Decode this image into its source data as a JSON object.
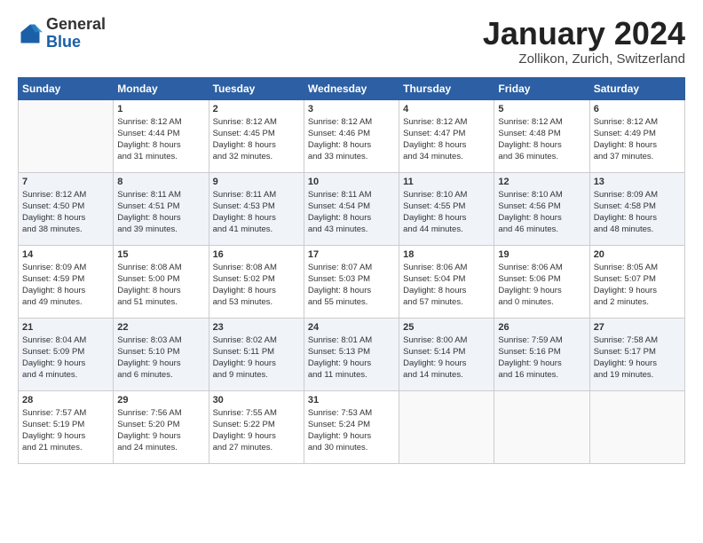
{
  "header": {
    "logo_general": "General",
    "logo_blue": "Blue",
    "month_title": "January 2024",
    "location": "Zollikon, Zurich, Switzerland"
  },
  "days_of_week": [
    "Sunday",
    "Monday",
    "Tuesday",
    "Wednesday",
    "Thursday",
    "Friday",
    "Saturday"
  ],
  "weeks": [
    [
      {
        "day": "",
        "info": ""
      },
      {
        "day": "1",
        "info": "Sunrise: 8:12 AM\nSunset: 4:44 PM\nDaylight: 8 hours\nand 31 minutes."
      },
      {
        "day": "2",
        "info": "Sunrise: 8:12 AM\nSunset: 4:45 PM\nDaylight: 8 hours\nand 32 minutes."
      },
      {
        "day": "3",
        "info": "Sunrise: 8:12 AM\nSunset: 4:46 PM\nDaylight: 8 hours\nand 33 minutes."
      },
      {
        "day": "4",
        "info": "Sunrise: 8:12 AM\nSunset: 4:47 PM\nDaylight: 8 hours\nand 34 minutes."
      },
      {
        "day": "5",
        "info": "Sunrise: 8:12 AM\nSunset: 4:48 PM\nDaylight: 8 hours\nand 36 minutes."
      },
      {
        "day": "6",
        "info": "Sunrise: 8:12 AM\nSunset: 4:49 PM\nDaylight: 8 hours\nand 37 minutes."
      }
    ],
    [
      {
        "day": "7",
        "info": "Sunrise: 8:12 AM\nSunset: 4:50 PM\nDaylight: 8 hours\nand 38 minutes."
      },
      {
        "day": "8",
        "info": "Sunrise: 8:11 AM\nSunset: 4:51 PM\nDaylight: 8 hours\nand 39 minutes."
      },
      {
        "day": "9",
        "info": "Sunrise: 8:11 AM\nSunset: 4:53 PM\nDaylight: 8 hours\nand 41 minutes."
      },
      {
        "day": "10",
        "info": "Sunrise: 8:11 AM\nSunset: 4:54 PM\nDaylight: 8 hours\nand 43 minutes."
      },
      {
        "day": "11",
        "info": "Sunrise: 8:10 AM\nSunset: 4:55 PM\nDaylight: 8 hours\nand 44 minutes."
      },
      {
        "day": "12",
        "info": "Sunrise: 8:10 AM\nSunset: 4:56 PM\nDaylight: 8 hours\nand 46 minutes."
      },
      {
        "day": "13",
        "info": "Sunrise: 8:09 AM\nSunset: 4:58 PM\nDaylight: 8 hours\nand 48 minutes."
      }
    ],
    [
      {
        "day": "14",
        "info": "Sunrise: 8:09 AM\nSunset: 4:59 PM\nDaylight: 8 hours\nand 49 minutes."
      },
      {
        "day": "15",
        "info": "Sunrise: 8:08 AM\nSunset: 5:00 PM\nDaylight: 8 hours\nand 51 minutes."
      },
      {
        "day": "16",
        "info": "Sunrise: 8:08 AM\nSunset: 5:02 PM\nDaylight: 8 hours\nand 53 minutes."
      },
      {
        "day": "17",
        "info": "Sunrise: 8:07 AM\nSunset: 5:03 PM\nDaylight: 8 hours\nand 55 minutes."
      },
      {
        "day": "18",
        "info": "Sunrise: 8:06 AM\nSunset: 5:04 PM\nDaylight: 8 hours\nand 57 minutes."
      },
      {
        "day": "19",
        "info": "Sunrise: 8:06 AM\nSunset: 5:06 PM\nDaylight: 9 hours\nand 0 minutes."
      },
      {
        "day": "20",
        "info": "Sunrise: 8:05 AM\nSunset: 5:07 PM\nDaylight: 9 hours\nand 2 minutes."
      }
    ],
    [
      {
        "day": "21",
        "info": "Sunrise: 8:04 AM\nSunset: 5:09 PM\nDaylight: 9 hours\nand 4 minutes."
      },
      {
        "day": "22",
        "info": "Sunrise: 8:03 AM\nSunset: 5:10 PM\nDaylight: 9 hours\nand 6 minutes."
      },
      {
        "day": "23",
        "info": "Sunrise: 8:02 AM\nSunset: 5:11 PM\nDaylight: 9 hours\nand 9 minutes."
      },
      {
        "day": "24",
        "info": "Sunrise: 8:01 AM\nSunset: 5:13 PM\nDaylight: 9 hours\nand 11 minutes."
      },
      {
        "day": "25",
        "info": "Sunrise: 8:00 AM\nSunset: 5:14 PM\nDaylight: 9 hours\nand 14 minutes."
      },
      {
        "day": "26",
        "info": "Sunrise: 7:59 AM\nSunset: 5:16 PM\nDaylight: 9 hours\nand 16 minutes."
      },
      {
        "day": "27",
        "info": "Sunrise: 7:58 AM\nSunset: 5:17 PM\nDaylight: 9 hours\nand 19 minutes."
      }
    ],
    [
      {
        "day": "28",
        "info": "Sunrise: 7:57 AM\nSunset: 5:19 PM\nDaylight: 9 hours\nand 21 minutes."
      },
      {
        "day": "29",
        "info": "Sunrise: 7:56 AM\nSunset: 5:20 PM\nDaylight: 9 hours\nand 24 minutes."
      },
      {
        "day": "30",
        "info": "Sunrise: 7:55 AM\nSunset: 5:22 PM\nDaylight: 9 hours\nand 27 minutes."
      },
      {
        "day": "31",
        "info": "Sunrise: 7:53 AM\nSunset: 5:24 PM\nDaylight: 9 hours\nand 30 minutes."
      },
      {
        "day": "",
        "info": ""
      },
      {
        "day": "",
        "info": ""
      },
      {
        "day": "",
        "info": ""
      }
    ]
  ]
}
